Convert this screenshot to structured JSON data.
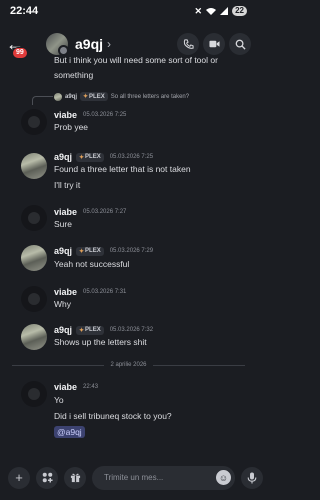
{
  "status": {
    "time": "22:44",
    "battery": "22"
  },
  "header": {
    "back_badge": "99",
    "channel_name": "a9qj",
    "chevron": "›"
  },
  "messages": {
    "partial_top": {
      "line1": "But i think you will need some sort of tool or",
      "line2": "something"
    },
    "m1": {
      "reply_author": "a9qj",
      "reply_tag": "PLEX",
      "reply_text": "So all three letters are taken?",
      "author": "viabe",
      "time": "05.03.2026 7:25",
      "text": "Prob yee"
    },
    "m2": {
      "author": "a9qj",
      "tag": "PLEX",
      "time": "05.03.2026 7:25",
      "line1": "Found a three letter that is not taken",
      "line2": "I'll try it"
    },
    "m3": {
      "author": "viabe",
      "time": "05.03.2026 7:27",
      "text": "Sure"
    },
    "m4": {
      "author": "a9qj",
      "tag": "PLEX",
      "time": "05.03.2026 7:29",
      "text": "Yeah not successful"
    },
    "m5": {
      "author": "viabe",
      "time": "05.03.2026 7:31",
      "text": "Why"
    },
    "m6": {
      "author": "a9qj",
      "tag": "PLEX",
      "time": "05.03.2026 7:32",
      "text": "Shows up the letters shit"
    },
    "divider": "2 aprilie 2026",
    "m7": {
      "author": "viabe",
      "time": "22:43",
      "line1": "Yo",
      "line2": "Did i sell tribuneq stock to you?",
      "mention": "@a9qj"
    }
  },
  "composer": {
    "placeholder": "Trimite un mes..."
  },
  "icons": {
    "status": [
      "mute-icon",
      "wifi-icon",
      "signal-icon",
      "battery-icon"
    ],
    "header": [
      "back-arrow-icon",
      "call-icon",
      "video-icon",
      "search-icon"
    ],
    "composer": [
      "plus-icon",
      "apps-icon",
      "gift-icon",
      "emoji-icon",
      "microphone-icon"
    ]
  },
  "colors": {
    "background": "#1b1d22",
    "mention_bg": "#3c4270",
    "badge": "#e03b3b"
  }
}
